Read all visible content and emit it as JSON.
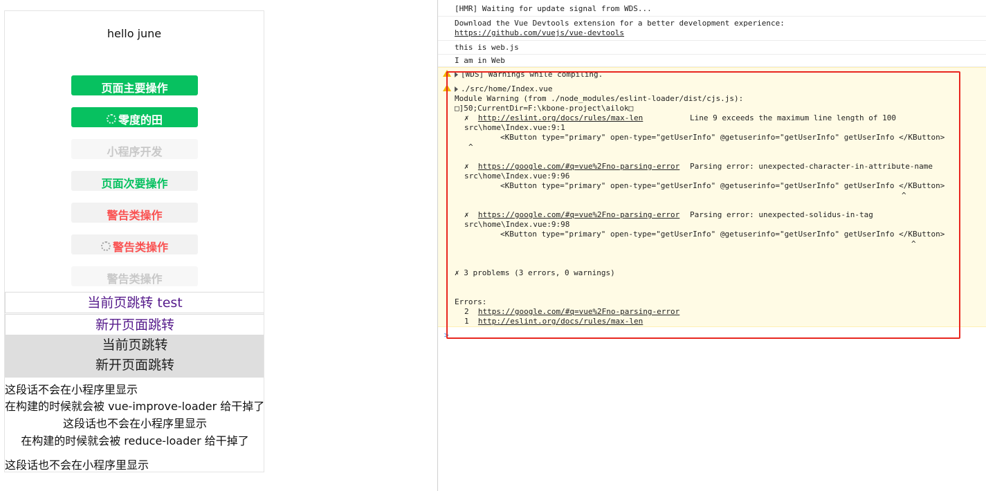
{
  "preview": {
    "hello": "hello june",
    "buttons": [
      {
        "label": "页面主要操作",
        "style": "primary",
        "loading": false
      },
      {
        "label": "零度的田",
        "style": "primary",
        "loading": true
      },
      {
        "label": "小程序开发",
        "style": "disabled",
        "loading": false
      },
      {
        "label": "页面次要操作",
        "style": "default",
        "loading": false
      },
      {
        "label": "警告类操作",
        "style": "warn",
        "loading": false
      },
      {
        "label": "警告类操作",
        "style": "warn",
        "loading": true
      },
      {
        "label": "警告类操作",
        "style": "disabled",
        "loading": false
      }
    ],
    "links": {
      "current_test": "当前页跳转 test",
      "new_page": "新开页面跳转"
    },
    "gray_links": {
      "current": "当前页跳转",
      "new_page": "新开页面跳转"
    },
    "texts": {
      "t1": "这段话不会在小程序里显示",
      "t2": "在构建的时候就会被 vue-improve-loader 给干掉了",
      "t3": "这段话也不会在小程序里显示",
      "t4": "在构建的时候就会被 reduce-loader 给干掉了",
      "t5": "这段话也不会在小程序里显示"
    }
  },
  "console": {
    "hmr": "[HMR] Waiting for update signal from WDS...",
    "devtools_line1": "Download the Vue Devtools extension for a better development experience:",
    "devtools_link": "https://github.com/vuejs/vue-devtools",
    "web_js": "this is web.js",
    "in_web": "I am in Web",
    "wds_warning": "[WDS] Warnings while compiling.",
    "file": "./src/home/Index.vue",
    "module_warning": "Module Warning (from ./node_modules/eslint-loader/dist/cjs.js):",
    "cwd": "□]50;CurrentDir=F:\\kbone-project\\ailok□",
    "err1": {
      "mark": "✗",
      "link": "http://eslint.org/docs/rules/max-len",
      "message": "Line 9 exceeds the maximum line length of 100",
      "location": "src\\home\\Index.vue:9:1",
      "code": "<KButton type=\"primary\" open-type=\"getUserInfo\" @getuserinfo=\"getUserInfo\" getUserInfo </KButton>",
      "caret": "^"
    },
    "err2": {
      "mark": "✗",
      "link": "https://google.com/#q=vue%2Fno-parsing-error",
      "message": "Parsing error: unexpected-character-in-attribute-name",
      "location": "src\\home\\Index.vue:9:96",
      "code": "<KButton type=\"primary\" open-type=\"getUserInfo\" @getuserinfo=\"getUserInfo\" getUserInfo </KButton>",
      "caret": "^"
    },
    "err3": {
      "mark": "✗",
      "link": "https://google.com/#q=vue%2Fno-parsing-error",
      "message": "Parsing error: unexpected-solidus-in-tag",
      "location": "src\\home\\Index.vue:9:98",
      "code": "<KButton type=\"primary\" open-type=\"getUserInfo\" @getuserinfo=\"getUserInfo\" getUserInfo </KButton>",
      "caret": "^"
    },
    "problems": "✗ 3 problems (3 errors, 0 warnings)",
    "errors_label": "Errors:",
    "errors": [
      {
        "count": "2",
        "link": "https://google.com/#q=vue%2Fno-parsing-error"
      },
      {
        "count": "1",
        "link": "http://eslint.org/docs/rules/max-len"
      }
    ],
    "prompt": ">"
  },
  "colors": {
    "primary": "#07c160",
    "warn": "#fa5151",
    "highlight": "#e8261f",
    "warning_bg": "#fffbe5"
  }
}
